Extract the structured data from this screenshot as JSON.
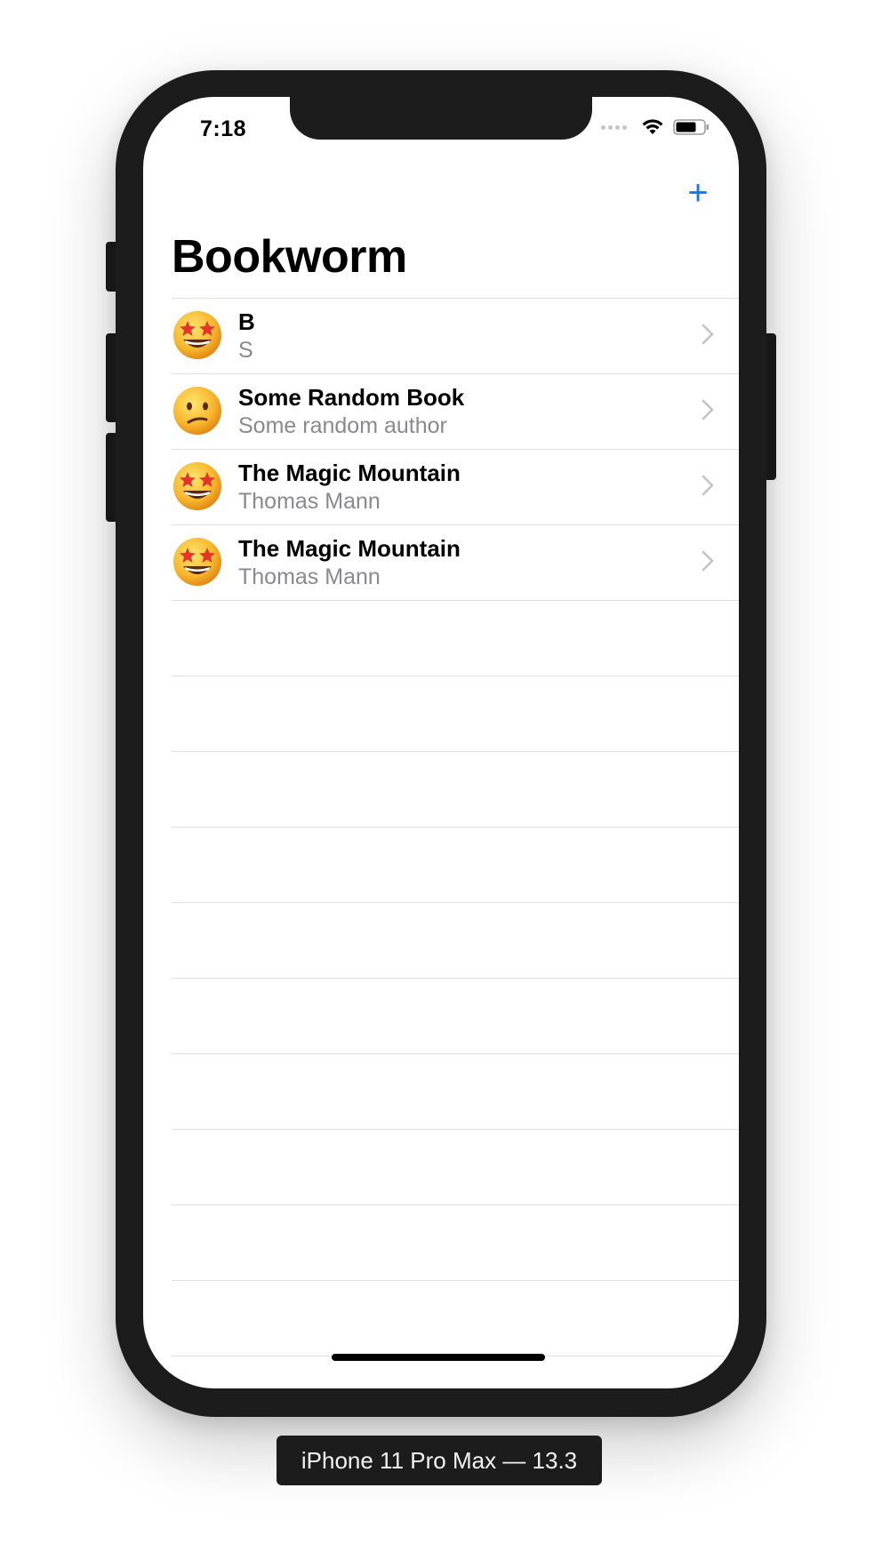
{
  "status_bar": {
    "time": "7:18"
  },
  "nav": {
    "title": "Bookworm",
    "add_button_label": "+"
  },
  "books": [
    {
      "title": "B",
      "author": "S",
      "rating_emoji": "star-struck"
    },
    {
      "title": "Some Random Book",
      "author": "Some random author",
      "rating_emoji": "confused"
    },
    {
      "title": "The Magic Mountain",
      "author": "Thomas Mann",
      "rating_emoji": "star-struck"
    },
    {
      "title": "The Magic Mountain",
      "author": "Thomas Mann",
      "rating_emoji": "star-struck"
    }
  ],
  "device_label": "iPhone 11 Pro Max — 13.3",
  "colors": {
    "accent": "#0a7aff",
    "secondary_text": "#8a8a8e",
    "separator": "#e0e0e0",
    "device_frame": "#1c1c1c"
  },
  "icons": [
    "plus-icon",
    "chevron-right-icon",
    "wifi-icon",
    "battery-icon",
    "signal-icon",
    "star-struck-emoji-icon",
    "confused-emoji-icon"
  ]
}
